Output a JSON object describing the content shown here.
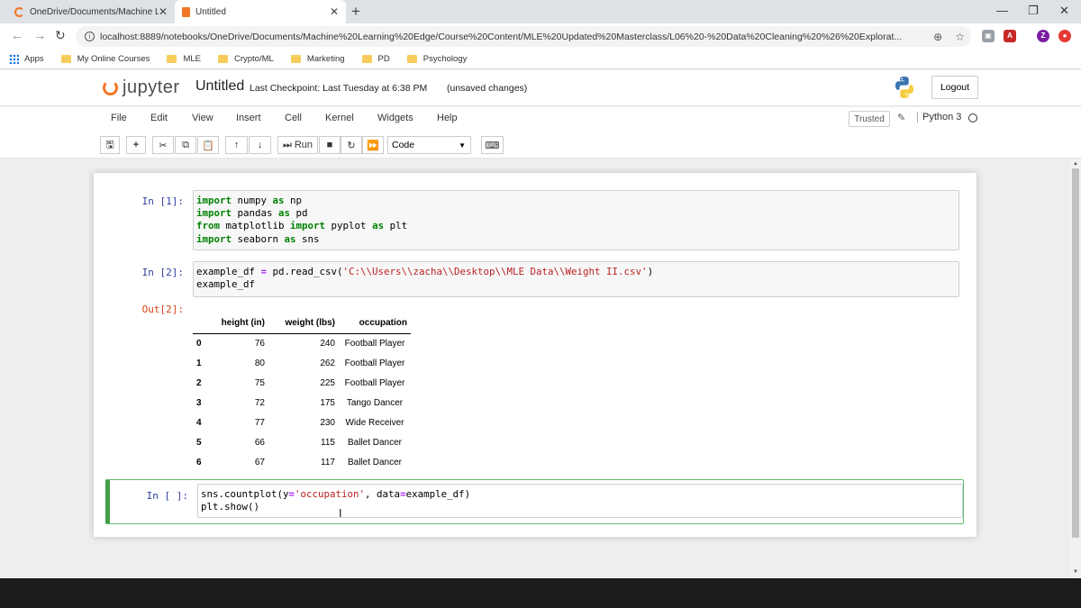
{
  "browser": {
    "tabs": [
      {
        "title": "OneDrive/Documents/Machine L",
        "active": false
      },
      {
        "title": "Untitled",
        "active": true
      }
    ],
    "url": "localhost:8889/notebooks/OneDrive/Documents/Machine%20Learning%20Edge/Course%20Content/MLE%20Updated%20Masterclass/L06%20-%20Data%20Cleaning%20%26%20Explorat...",
    "bookmarks": [
      "Apps",
      "My Online Courses",
      "MLE",
      "Crypto/ML",
      "Marketing",
      "PD",
      "Psychology"
    ],
    "profile_initial": "Z"
  },
  "jupyter": {
    "logo_text": "jupyter",
    "notebook_name": "Untitled",
    "checkpoint": "Last Checkpoint: Last Tuesday at 6:38 PM",
    "unsaved": "(unsaved changes)",
    "logout_label": "Logout",
    "menu": [
      "File",
      "Edit",
      "View",
      "Insert",
      "Cell",
      "Kernel",
      "Widgets",
      "Help"
    ],
    "trusted_label": "Trusted",
    "kernel_name": "Python 3",
    "toolbar": {
      "run_label": "Run",
      "cell_type": "Code"
    }
  },
  "cells": [
    {
      "prompt": "In [1]:"
    },
    {
      "prompt": "In [2]:"
    },
    {
      "out_prompt": "Out[2]:"
    },
    {
      "prompt": "In [ ]:"
    }
  ],
  "dataframe": {
    "columns": [
      "height (in)",
      "weight (lbs)",
      "occupation"
    ],
    "rows": [
      {
        "index": "0",
        "height": "76",
        "weight": "240",
        "occupation": "Football Player"
      },
      {
        "index": "1",
        "height": "80",
        "weight": "262",
        "occupation": "Football Player"
      },
      {
        "index": "2",
        "height": "75",
        "weight": "225",
        "occupation": "Football Player"
      },
      {
        "index": "3",
        "height": "72",
        "weight": "175",
        "occupation": "Tango Dancer"
      },
      {
        "index": "4",
        "height": "77",
        "weight": "230",
        "occupation": "Wide Receiver"
      },
      {
        "index": "5",
        "height": "66",
        "weight": "115",
        "occupation": "Ballet Dancer"
      },
      {
        "index": "6",
        "height": "67",
        "weight": "117",
        "occupation": "Ballet Dancer"
      }
    ]
  },
  "code": {
    "cell1": {
      "l1_kw": "import",
      "l1_rest": " numpy ",
      "l1_as": "as",
      "l1_name": " np",
      "l2_kw": "import",
      "l2_rest": " pandas ",
      "l2_as": "as",
      "l2_name": " pd",
      "l3_kw": "from",
      "l3_mod": " matplotlib ",
      "l3_imp": "import",
      "l3_rest": " pyplot ",
      "l3_as": "as",
      "l3_name": " plt",
      "l4_kw": "import",
      "l4_rest": " seaborn ",
      "l4_as": "as",
      "l4_name": " sns"
    },
    "cell2": {
      "l1_a": "example_df ",
      "l1_eq": "=",
      "l1_b": " pd.read_csv(",
      "l1_str": "'C:\\\\Users\\\\zacha\\\\Desktop\\\\MLE Data\\\\Weight II.csv'",
      "l1_c": ")",
      "l2": "example_df"
    },
    "cell3": {
      "l1_a": "sns.countplot(y",
      "l1_eq1": "=",
      "l1_str": "'occupation'",
      "l1_b": ", data",
      "l1_eq2": "=",
      "l1_c": "example_df)",
      "l2": "plt.show()"
    }
  },
  "colors": {
    "accent_orange": "#f37626",
    "prompt_in": "#303f9f",
    "prompt_out": "#d84315",
    "selected_cell": "#42a047"
  }
}
